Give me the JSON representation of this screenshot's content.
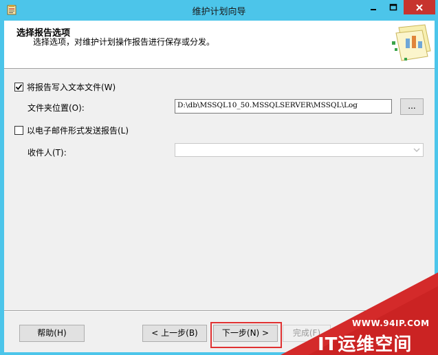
{
  "window": {
    "title": "维护计划向导",
    "controls": {
      "minimize_icon": "minimize-icon",
      "maximize_icon": "maximize-icon",
      "close_icon": "close-icon"
    }
  },
  "header": {
    "title": "选择报告选项",
    "subtitle": "选择选项，对维护计划操作报告进行保存或分发。"
  },
  "form": {
    "write_to_file": {
      "label": "将报告写入文本文件(W)",
      "checked": true
    },
    "folder_location": {
      "label": "文件夹位置(O):",
      "value": "D:\\db\\MSSQL10_50.MSSQLSERVER\\MSSQL\\Log",
      "browse_label": "..."
    },
    "email_report": {
      "label": "以电子邮件形式发送报告(L)",
      "checked": false
    },
    "recipient": {
      "label": "收件人(T):",
      "value": ""
    }
  },
  "footer": {
    "help_label": "帮助(H)",
    "back_label": "< 上一步(B)",
    "next_label": "下一步(N) >",
    "finish_label": "完成(F)"
  },
  "watermark": {
    "url": "WWW.94IP.COM",
    "name": "IT运维空间"
  },
  "colors": {
    "titlebar": "#4cc5ea",
    "close_button": "#c7342e",
    "highlight": "#e03030",
    "watermark": "#d42a2a"
  }
}
